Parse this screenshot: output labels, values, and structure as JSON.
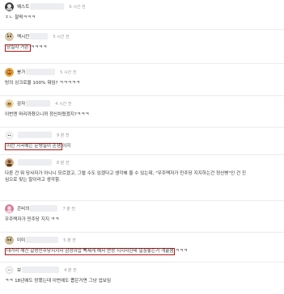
{
  "comments": [
    {
      "name": "웨스트",
      "time": "6 시간 전",
      "text": "ㅈㄴ 찰떡ㅋㅋㅋ",
      "mark": "",
      "rest": ""
    },
    {
      "name": "멕시칸",
      "time": "5 시간 전",
      "text": "",
      "mark": "당실자 거존",
      "rest": "ㅋㅋㅋㅋ"
    },
    {
      "name": "붕가",
      "time": "5 시간 전",
      "text": "빙의 싱크로율 100% 뭐임? ㅋㅋㅋㅋㅋ",
      "mark": "",
      "rest": ""
    },
    {
      "name": "감자",
      "time": "4 시간 전",
      "text": "이번엔 머리까졌으니까 정신차렸겠지?ㅋㅋㅋ",
      "mark": "",
      "rest": ""
    },
    {
      "name": "",
      "time": "9 분 전",
      "text": "",
      "mark": "이런 시국에는 운땡칠이 존잼",
      "rest": "이지"
    },
    {
      "name": "",
      "time": "8 분 전",
      "text": "다른 건 뭐 당사자가 아니니 모르겠고, 그럴 수도 있겠다고 생각해 줄 수 있는데, \"우주택자가 민주당 지지하는건 정신병\"인 건 진심으로 맞는 말이라고 생각함.",
      "mark": "",
      "rest": ""
    },
    {
      "name": "콘비의",
      "time": "7 분 전",
      "text": "우주택자가 민주당 지지 ㅋㅋ",
      "mark": "",
      "rest": ""
    },
    {
      "name": "미미",
      "time": "5 분 전",
      "text": "",
      "mark": "대가리 깨진 갈성민주당지지자 감정이입 빡세게 해서 연성 지지자한테 일침놓는거 개꿀잼",
      "rest": "ㅋㅋㅋ"
    },
    {
      "name": "보",
      "time": "4 분 전",
      "text": "ㅋㅋ 18년에도 망했는데 이번에도 뽑은거면 그냥 업보임",
      "mark": "",
      "rest": ""
    }
  ],
  "colors": {
    "mark_border": "#b01717",
    "time": "#9a9a9a",
    "divider": "#ececec"
  },
  "avatars": [
    "profile-avatar-bw",
    "profile-avatar-cat",
    "profile-avatar-orange",
    "profile-avatar-dog",
    "profile-avatar-dog-white",
    "profile-avatar-person",
    "profile-avatar-pink",
    "profile-avatar-cat",
    "profile-avatar-white"
  ]
}
